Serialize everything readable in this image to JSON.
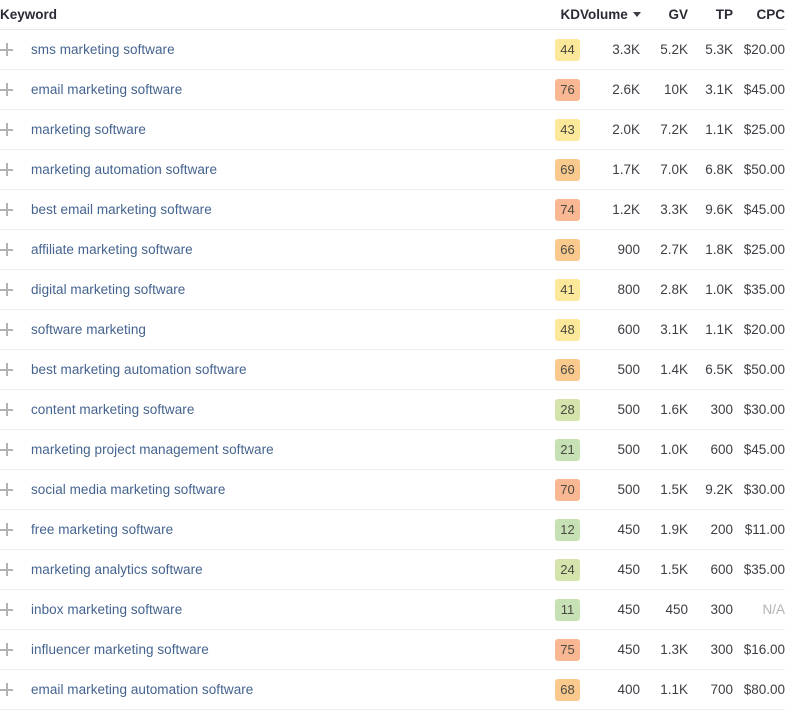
{
  "table": {
    "columns": {
      "keyword": "Keyword",
      "kd": "KD",
      "volume": "Volume",
      "gv": "GV",
      "tp": "TP",
      "cpc": "CPC"
    },
    "sort": {
      "column": "Volume",
      "direction": "desc",
      "icon": "caret-down-icon"
    },
    "row_icon": "plus-icon",
    "kd_colors": {
      "green": "#c6e2b4",
      "light_green": "#d5e3ac",
      "yellow": "#fbe89a",
      "orange": "#f9c98e",
      "salmon": "#f9b793"
    },
    "link_color": "#44638f",
    "rows": [
      {
        "keyword": "sms marketing software",
        "kd": "44",
        "kd_class": "kd-yellow",
        "volume": "3.3K",
        "gv": "5.2K",
        "tp": "5.3K",
        "cpc": "$20.00"
      },
      {
        "keyword": "email marketing software",
        "kd": "76",
        "kd_class": "kd-salmon",
        "volume": "2.6K",
        "gv": "10K",
        "tp": "3.1K",
        "cpc": "$45.00"
      },
      {
        "keyword": "marketing software",
        "kd": "43",
        "kd_class": "kd-yellow",
        "volume": "2.0K",
        "gv": "7.2K",
        "tp": "1.1K",
        "cpc": "$25.00"
      },
      {
        "keyword": "marketing automation software",
        "kd": "69",
        "kd_class": "kd-orange",
        "volume": "1.7K",
        "gv": "7.0K",
        "tp": "6.8K",
        "cpc": "$50.00"
      },
      {
        "keyword": "best email marketing software",
        "kd": "74",
        "kd_class": "kd-salmon",
        "volume": "1.2K",
        "gv": "3.3K",
        "tp": "9.6K",
        "cpc": "$45.00"
      },
      {
        "keyword": "affiliate marketing software",
        "kd": "66",
        "kd_class": "kd-orange",
        "volume": "900",
        "gv": "2.7K",
        "tp": "1.8K",
        "cpc": "$25.00"
      },
      {
        "keyword": "digital marketing software",
        "kd": "41",
        "kd_class": "kd-yellow",
        "volume": "800",
        "gv": "2.8K",
        "tp": "1.0K",
        "cpc": "$35.00"
      },
      {
        "keyword": "software marketing",
        "kd": "48",
        "kd_class": "kd-yellow",
        "volume": "600",
        "gv": "3.1K",
        "tp": "1.1K",
        "cpc": "$20.00"
      },
      {
        "keyword": "best marketing automation software",
        "kd": "66",
        "kd_class": "kd-orange",
        "volume": "500",
        "gv": "1.4K",
        "tp": "6.5K",
        "cpc": "$50.00"
      },
      {
        "keyword": "content marketing software",
        "kd": "28",
        "kd_class": "kd-lgreen",
        "volume": "500",
        "gv": "1.6K",
        "tp": "300",
        "cpc": "$30.00"
      },
      {
        "keyword": "marketing project management software",
        "kd": "21",
        "kd_class": "kd-green",
        "volume": "500",
        "gv": "1.0K",
        "tp": "600",
        "cpc": "$45.00"
      },
      {
        "keyword": "social media marketing software",
        "kd": "70",
        "kd_class": "kd-salmon",
        "volume": "500",
        "gv": "1.5K",
        "tp": "9.2K",
        "cpc": "$30.00"
      },
      {
        "keyword": "free marketing software",
        "kd": "12",
        "kd_class": "kd-green",
        "volume": "450",
        "gv": "1.9K",
        "tp": "200",
        "cpc": "$11.00"
      },
      {
        "keyword": "marketing analytics software",
        "kd": "24",
        "kd_class": "kd-lgreen",
        "volume": "450",
        "gv": "1.5K",
        "tp": "600",
        "cpc": "$35.00"
      },
      {
        "keyword": "inbox marketing software",
        "kd": "11",
        "kd_class": "kd-green",
        "volume": "450",
        "gv": "450",
        "tp": "300",
        "cpc": "N/A"
      },
      {
        "keyword": "influencer marketing software",
        "kd": "75",
        "kd_class": "kd-salmon",
        "volume": "450",
        "gv": "1.3K",
        "tp": "300",
        "cpc": "$16.00"
      },
      {
        "keyword": "email marketing automation software",
        "kd": "68",
        "kd_class": "kd-orange",
        "volume": "400",
        "gv": "1.1K",
        "tp": "700",
        "cpc": "$80.00"
      }
    ]
  }
}
